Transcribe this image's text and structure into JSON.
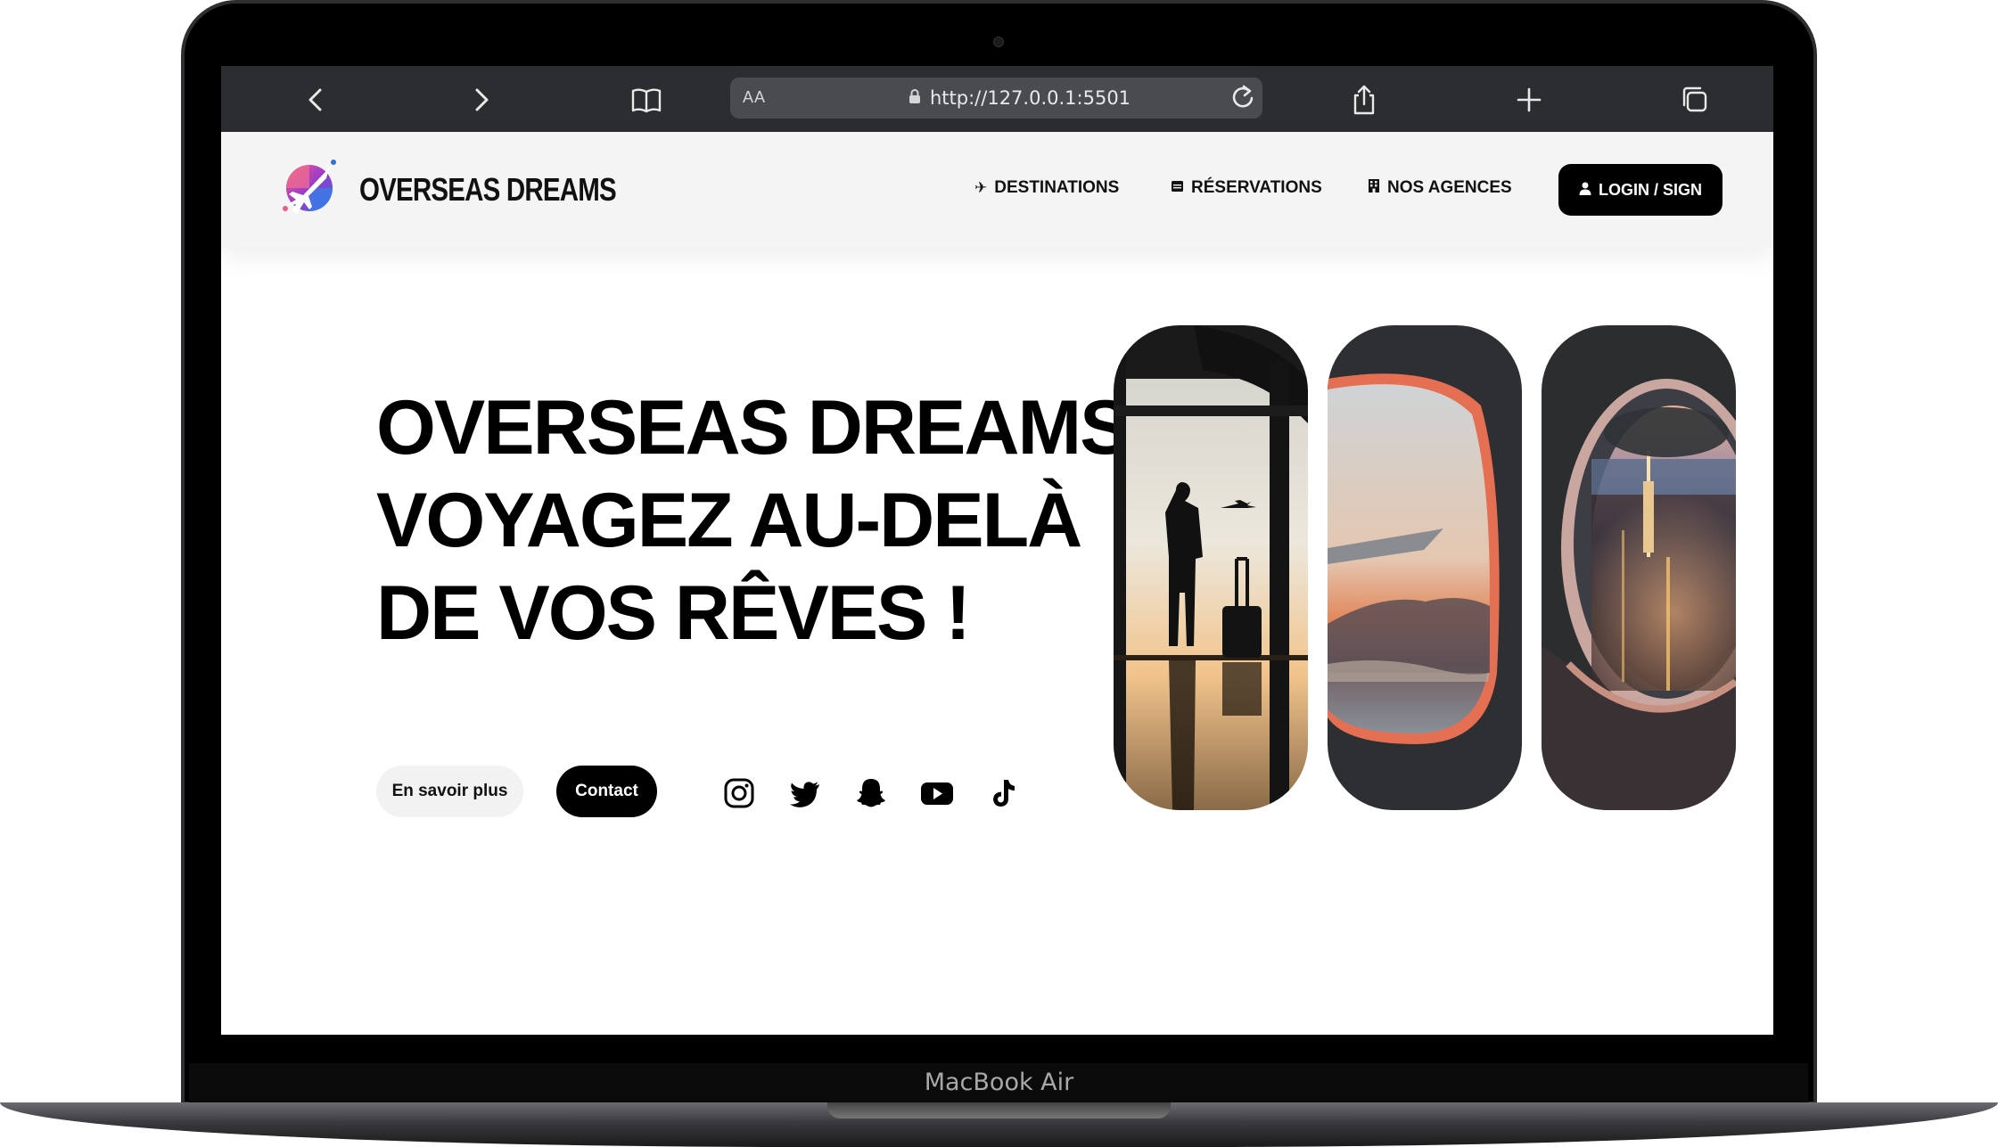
{
  "device": {
    "model_label": "MacBook Air"
  },
  "browser": {
    "text_size_label": "AA",
    "url": "http://127.0.0.1:5501"
  },
  "site": {
    "brand": "OVERSEAS DREAMS",
    "nav": [
      {
        "label": "DESTINATIONS",
        "icon": "plane-icon"
      },
      {
        "label": "RÉSERVATIONS",
        "icon": "calendar-icon"
      },
      {
        "label": "NOS AGENCES",
        "icon": "building-icon"
      }
    ],
    "login_label": "LOGIN / SIGN",
    "hero": {
      "line1": "OVERSEAS DREAMS",
      "line2": "VOYAGEZ AU-DELÀ",
      "line3": "DE VOS RÊVES !"
    },
    "buttons": {
      "more": "En savoir plus",
      "contact": "Contact"
    },
    "social": [
      "instagram-icon",
      "twitter-icon",
      "snapchat-icon",
      "youtube-icon",
      "tiktok-icon"
    ]
  },
  "colors": {
    "dark": "#000000",
    "header_bg": "#f4f4f4",
    "browser_bar": "#2b2d31"
  }
}
